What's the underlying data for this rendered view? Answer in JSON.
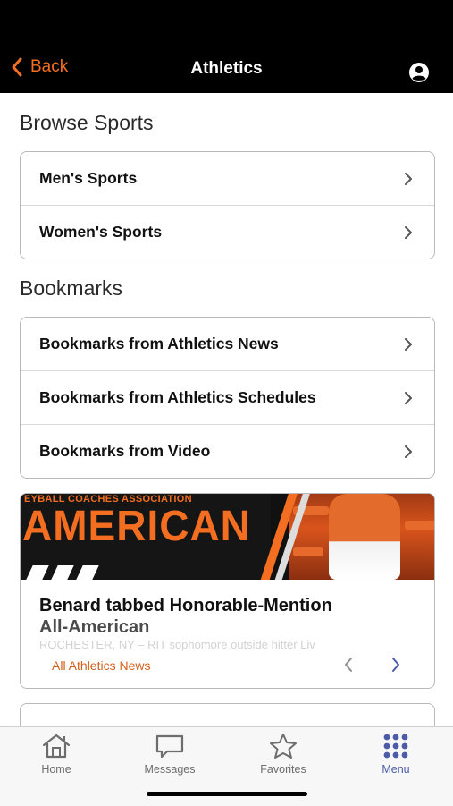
{
  "nav": {
    "back_label": "Back",
    "title": "Athletics"
  },
  "browse": {
    "title": "Browse Sports",
    "items": [
      {
        "label": "Men's Sports"
      },
      {
        "label": "Women's Sports"
      }
    ]
  },
  "bookmarks": {
    "title": "Bookmarks",
    "items": [
      {
        "label": "Bookmarks from Athletics News"
      },
      {
        "label": "Bookmarks from Athletics Schedules"
      },
      {
        "label": "Bookmarks from Video"
      }
    ]
  },
  "news": {
    "image_banner_small": "EYBALL COACHES ASSOCIATION",
    "image_banner_big": "AMERICAN",
    "headline_line1": "Benard tabbed Honorable-Mention",
    "headline_line2": "All-American",
    "snippet": "ROCHESTER, NY – RIT sophomore outside hitter Liv",
    "all_news_label": "All Athletics News"
  },
  "tabs": [
    {
      "label": "Home",
      "icon": "home-icon"
    },
    {
      "label": "Messages",
      "icon": "chat-bubble-icon"
    },
    {
      "label": "Favorites",
      "icon": "star-icon"
    },
    {
      "label": "Menu",
      "icon": "grid-dots-icon",
      "active": true
    }
  ],
  "colors": {
    "accent": "#f36e21",
    "active_tab": "#4b5ba8",
    "nav_bg": "#000000"
  }
}
